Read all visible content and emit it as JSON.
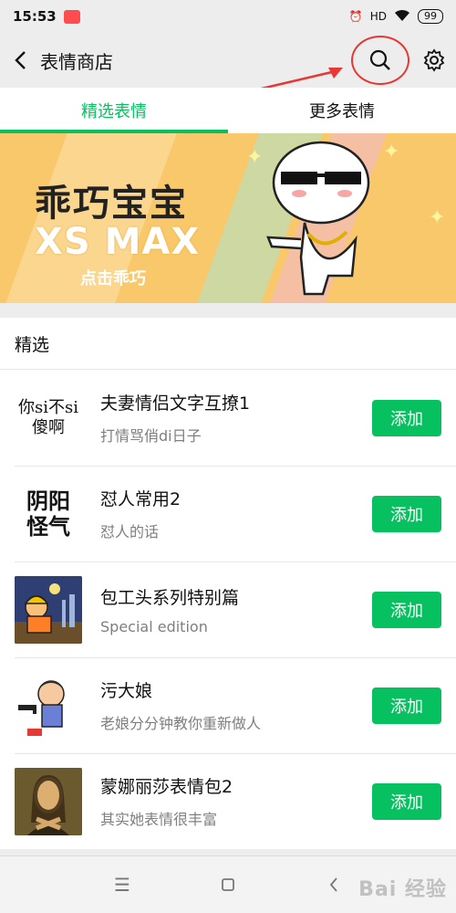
{
  "status_bar": {
    "time": "15:53",
    "network": "HD",
    "battery": "99"
  },
  "header": {
    "title": "表情商店"
  },
  "tabs": [
    {
      "label": "精选表情",
      "active": true
    },
    {
      "label": "更多表情",
      "active": false
    }
  ],
  "banner": {
    "title": "乖巧宝宝",
    "subtitle": "XS MAX",
    "cta": "点击乖巧"
  },
  "section": {
    "title": "精选"
  },
  "items": [
    {
      "name": "夫妻情侣文字互撩1",
      "desc": "打情骂俏di日子",
      "button": "添加",
      "thumb_text": "你si不si\n傻啊"
    },
    {
      "name": "怼人常用2",
      "desc": "怼人的话",
      "button": "添加",
      "thumb_text": "阴阳\n怪气"
    },
    {
      "name": "包工头系列特别篇",
      "desc": "Special edition",
      "button": "添加"
    },
    {
      "name": "污大娘",
      "desc": "老娘分分钟教你重新做人",
      "button": "添加"
    },
    {
      "name": "蒙娜丽莎表情包2",
      "desc": "其实她表情很丰富",
      "button": "添加"
    }
  ],
  "watermark": "Bai 经验",
  "colors": {
    "accent": "#07c160",
    "banner": "#f8c86a",
    "annotation": "#e53935"
  }
}
